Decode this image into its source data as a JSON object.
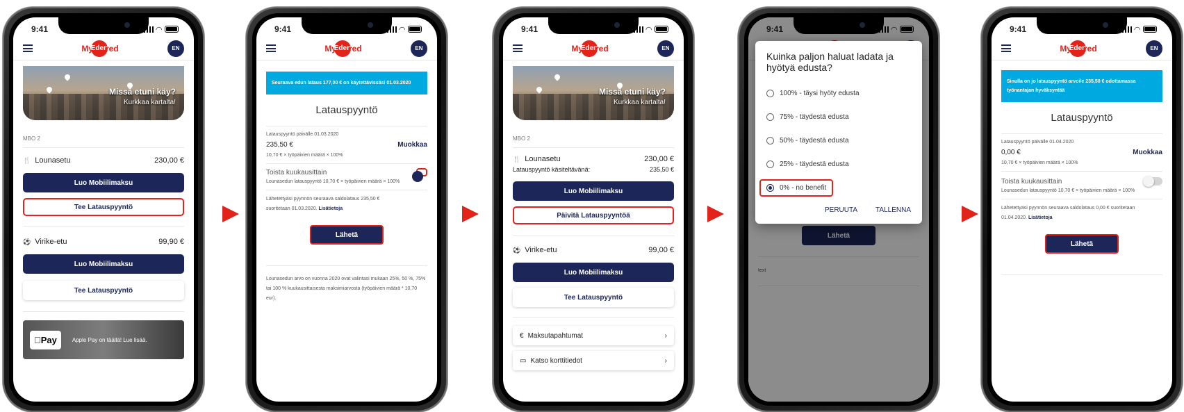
{
  "common": {
    "time": "9:41",
    "logo_pre": "My",
    "logo_circle": "Eden",
    "logo_post": "red",
    "lang": "EN"
  },
  "screen1": {
    "hero_title": "Missä etuni käy?",
    "hero_sub": "Kurkkaa kartalta!",
    "section": "MBO 2",
    "benefit1_name": "Lounasetu",
    "benefit1_amount": "230,00 €",
    "mobile_pay": "Luo Mobiilimaksu",
    "request": "Tee Latauspyyntö",
    "benefit2_name": "Virike-etu",
    "benefit2_amount": "99,90 €",
    "mobile_pay2": "Luo Mobiilimaksu",
    "request2": "Tee Latauspyyntö",
    "applepay_badge": "Pay",
    "applepay_text": "Apple Pay on täällä! Lue lisää."
  },
  "screen2": {
    "info": "Seuraava edun lataus 177,00 € on käytettävissäsi 01.03.2020",
    "heading": "Latauspyyntö",
    "date_label": "Latauspyyntö päivälle 01.03.2020",
    "amount": "235,50 €",
    "edit": "Muokkaa",
    "formula": "10,70 € × työpäivien määrä × 100%",
    "repeat": "Toista kuukausittain",
    "repeat_sub": "Lounasedun latauspyyntö 10,70 € × työpäivien määrä × 100%",
    "note_a": "Lähetettyäsi pyynnön seuraava saldolataus 235,50 €",
    "note_b": "suoritetaan 01.03.2020.",
    "more": "Lisätietoja",
    "send": "Lähetä",
    "long_text": "Lounasedun arvo on vuonna 2020 ovat valintasi mukaan 25%, 50 %, 75% tai 100 % kuukausittaisesta maksimiarvosta (työpäivien määrä * 10,70 eur)."
  },
  "screen3": {
    "hero_title": "Missä etuni käy?",
    "hero_sub": "Kurkkaa kartalta!",
    "section": "MBO 2",
    "benefit1_name": "Lounasetu",
    "benefit1_amount": "230,00 €",
    "pending_label": "Latauspyyntö käsiteltävänä:",
    "pending_amount": "235,50 €",
    "mobile_pay": "Luo Mobiilimaksu",
    "update_request": "Päivitä Latauspyyntöä",
    "benefit2_name": "Virike-etu",
    "benefit2_amount": "99,00 €",
    "mobile_pay2": "Luo Mobiilimaksu",
    "request2": "Tee Latauspyyntö",
    "transactions": "Maksutapahtumat",
    "card_details": "Katso korttitiedot"
  },
  "screen4": {
    "dialog_title": "Kuinka paljon haluat ladata ja hyötyä edusta?",
    "options": [
      "100% - täysi hyöty edusta",
      "75% - täydestä edusta",
      "50% - täydestä edusta",
      "25% - täydestä edusta",
      "0% - no benefit"
    ],
    "cancel": "PERUUTA",
    "save": "TALLENNA",
    "behind_button": "Lähetä",
    "behind_text": "text"
  },
  "screen5": {
    "info": "Sinulla on jo latauspyyntö arvoile 235,50 € odottamassa työnantajan hyväksyntää",
    "heading": "Latauspyyntö",
    "date_label": "Latauspyyntö päivälle 01.04.2020",
    "amount": "0,00 €",
    "edit": "Muokkaa",
    "formula": "10,70 € × työpäivien määrä × 100%",
    "repeat": "Toista kuukausittain",
    "repeat_sub": "Lounasedun latauspyyntö 10,70 € × työpäivien määrä × 100%",
    "note_a": "Lähetettyäsi pyynnön seuraava saldolataus 0,00 € suoritetaan",
    "note_b": "01.04.2020.",
    "more": "Lisätietoja",
    "send": "Lähetä"
  },
  "colors": {
    "brand_navy": "#1c2658",
    "brand_red": "#e2231a",
    "info_blue": "#00a9e0",
    "highlight": "#e2231a"
  }
}
